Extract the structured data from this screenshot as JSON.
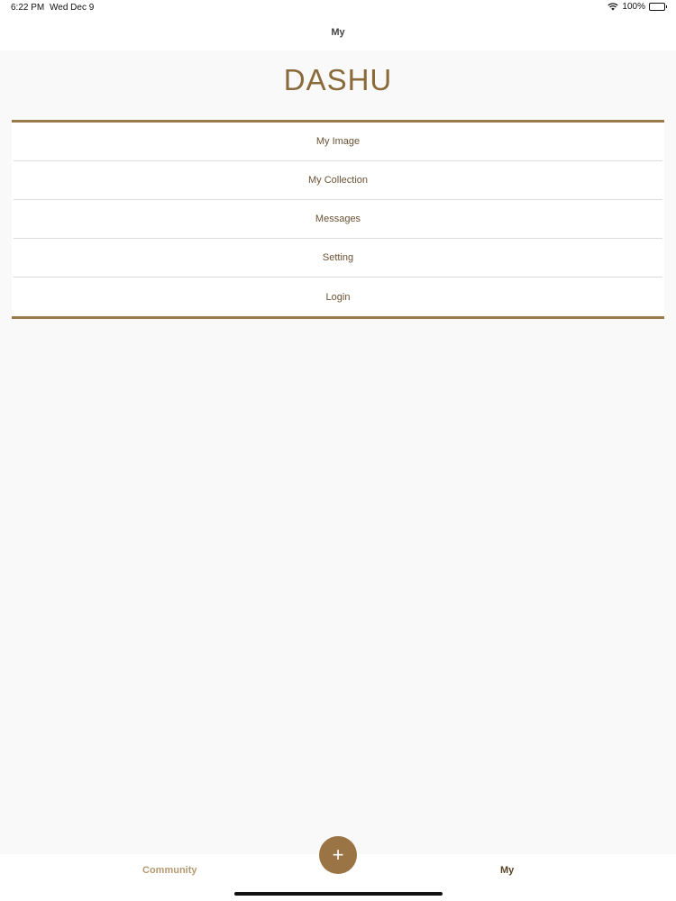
{
  "status_bar": {
    "time": "6:22 PM",
    "date": "Wed Dec 9",
    "battery": "100%"
  },
  "nav": {
    "title": "My"
  },
  "brand": {
    "name": "DASHU"
  },
  "menu": {
    "items": [
      {
        "label": "My Image"
      },
      {
        "label": "My Collection"
      },
      {
        "label": "Messages"
      },
      {
        "label": "Setting"
      },
      {
        "label": "Login"
      }
    ]
  },
  "tab_bar": {
    "community_label": "Community",
    "my_label": "My",
    "add_symbol": "+"
  },
  "colors": {
    "accent": "#9a7444",
    "brand_text": "#8a6a3a",
    "divider": "#9a7a4a"
  }
}
